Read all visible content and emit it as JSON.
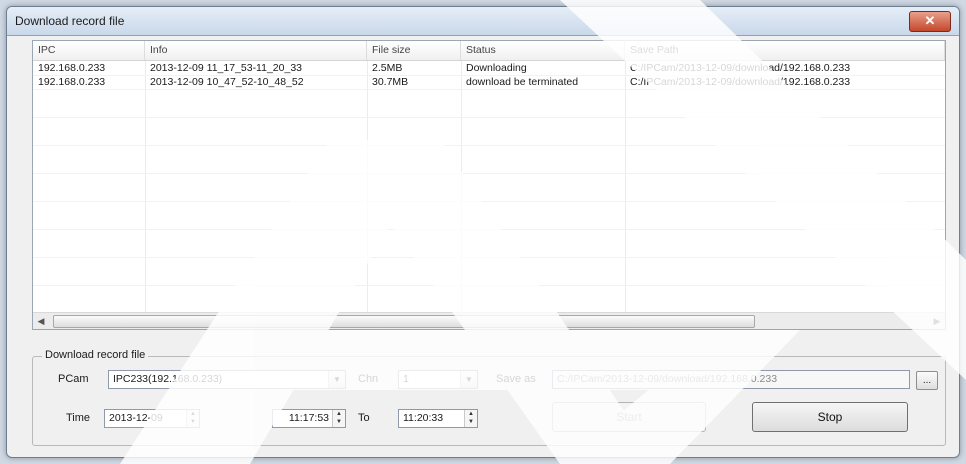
{
  "window": {
    "title": "Download record file",
    "close_label": "✕"
  },
  "table": {
    "columns": [
      "IPC",
      "Info",
      "File size",
      "Status",
      "Save Path"
    ],
    "rows": [
      [
        "192.168.0.233",
        "2013-12-09 11_17_53-11_20_33",
        "2.5MB",
        "Downloading",
        "C:/IPCam/2013-12-09/download/192.168.0.233"
      ],
      [
        "192.168.0.233",
        "2013-12-09 10_47_52-10_48_52",
        "30.7MB",
        "download be terminated",
        "C:/IPCam/2013-12-09/download/192.168.0.233"
      ]
    ]
  },
  "form": {
    "group_label": "Download record file",
    "pcam_label": "PCam",
    "pcam_value": "IPC233(192.168.0.233)",
    "chn_label": "Chn",
    "chn_value": "1",
    "saveas_label": "Save as",
    "saveas_value": "C:/IPCam/2013-12-09/download/192.168.0.233",
    "browse_label": "...",
    "time_label": "Time",
    "date_value": "2013-12-09",
    "start_time": "11:17:53",
    "to_label": "To",
    "end_time": "11:20:33",
    "start_button": "Start",
    "stop_button": "Stop"
  }
}
